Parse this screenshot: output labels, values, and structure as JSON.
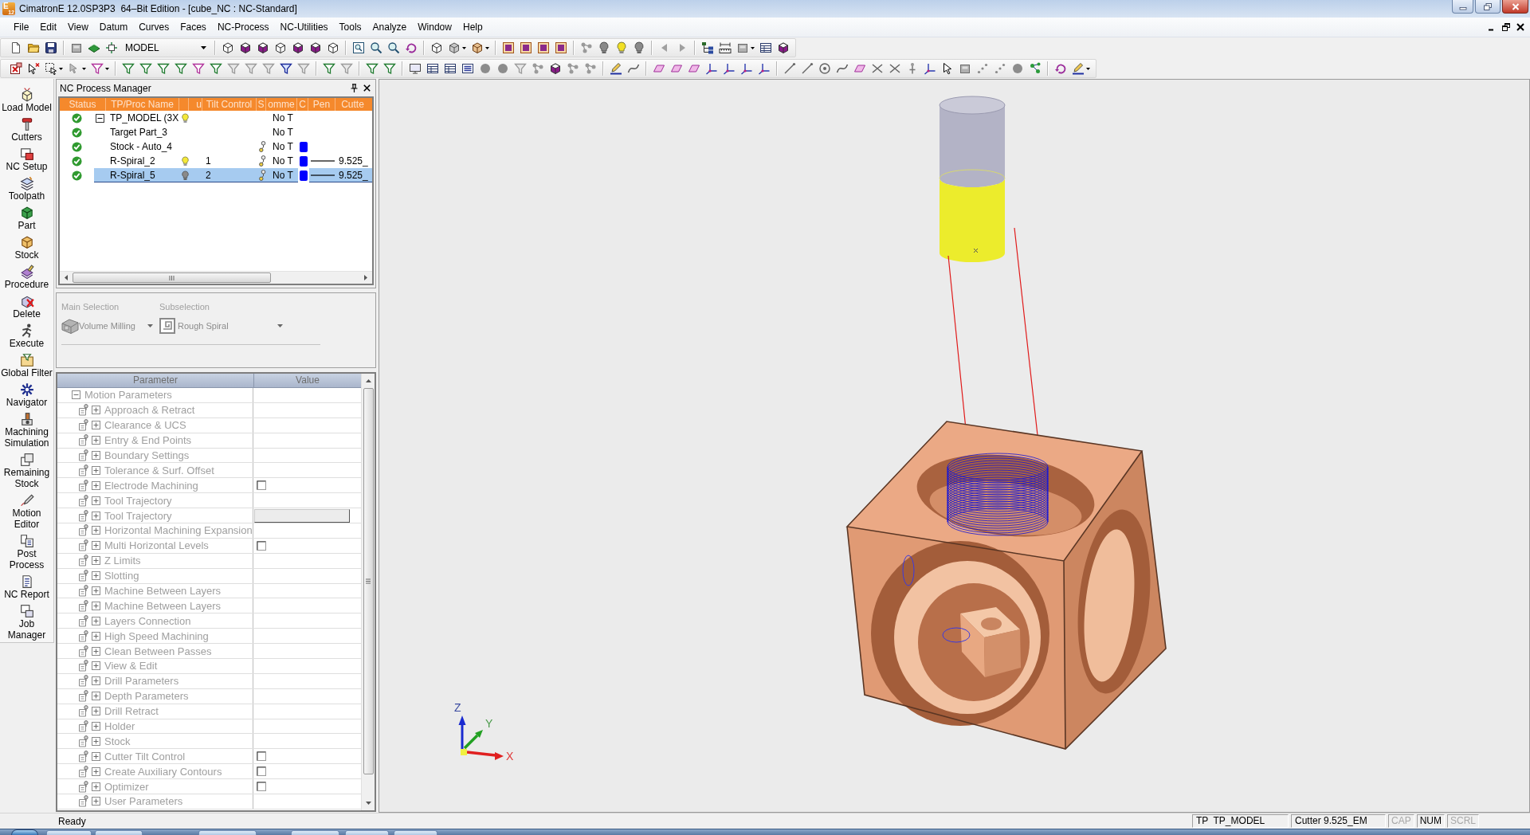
{
  "window": {
    "logo": {
      "letter": "E",
      "version": "12"
    },
    "title": "CimatronE 12.0SP3P3  64–Bit Edition - [cube_NC : NC-Standard]"
  },
  "menu": {
    "items": [
      "File",
      "Edit",
      "View",
      "Datum",
      "Curves",
      "Faces",
      "NC-Process",
      "NC-Utilities",
      "Tools",
      "Analyze",
      "Window",
      "Help"
    ]
  },
  "toolbar": {
    "view_combo": {
      "value": "MODEL"
    }
  },
  "sidebar": {
    "items": [
      "Load Model",
      "Cutters",
      "NC Setup",
      "Toolpath",
      "Part",
      "Stock",
      "Procedure",
      "Delete",
      "Execute",
      "Global Filter",
      "Navigator",
      "Machining Simulation",
      "Remaining Stock",
      "Motion Editor",
      "Post Process",
      "NC Report",
      "Job Manager"
    ]
  },
  "nc_process_manager": {
    "title": "NC Process Manager",
    "columns": [
      "Status",
      "TP/Proc Name",
      "u",
      "Tilt Control",
      "S",
      "omme",
      "C",
      "Pen",
      "Cutte"
    ],
    "tree": [
      {
        "name": "TP_MODEL (3X",
        "done": true,
        "bulb_on": true,
        "column_7": "No T",
        "expanded": true,
        "selected": false,
        "children": [
          {
            "name": "Target Part_3",
            "done": true,
            "column_7": "No T",
            "selected": false
          },
          {
            "name": "Stock - Auto_4",
            "done": true,
            "column_6_icon": true,
            "column_7": "No T",
            "color": "#0000ff",
            "selected": false
          },
          {
            "name": "R-Spiral_2",
            "done": true,
            "bulb_on": true,
            "tilt_control": "1",
            "column_6_icon": true,
            "column_7": "No T",
            "color": "#0000ff",
            "pen_line": true,
            "column_10": "9.525_",
            "selected": false
          },
          {
            "name": "R-Spiral_5",
            "done": true,
            "bulb_on": false,
            "tilt_control": "2",
            "column_6_icon": true,
            "column_7": "No T",
            "color": "#0000ff",
            "pen_line": true,
            "column_10": "9.525_",
            "selected": true
          }
        ]
      }
    ]
  },
  "selection": {
    "main": {
      "label": "Main Selection",
      "value": "Volume Milling",
      "disabled": true
    },
    "sub": {
      "label": "Subselection",
      "value": "Rough Spiral",
      "disabled": true
    }
  },
  "parameters": {
    "columns": [
      "Parameter",
      "Value"
    ],
    "disabled": true,
    "tree": [
      {
        "label": "Motion Parameters",
        "expanded": true,
        "children": [
          {
            "label": "Approach & Retract",
            "expanded": false,
            "kind": "plain"
          },
          {
            "label": "Clearance & UCS",
            "expanded": false,
            "kind": "plain"
          },
          {
            "label": "Entry & End Points",
            "expanded": false,
            "kind": "plain"
          },
          {
            "label": "Boundary Settings",
            "expanded": false,
            "kind": "plain"
          },
          {
            "label": "Tolerance & Surf. Offset",
            "expanded": false,
            "kind": "plain"
          },
          {
            "label": "Electrode Machining",
            "expanded": false,
            "kind": "checkbox",
            "checked": false
          },
          {
            "label": "Tool Trajectory",
            "expanded": false,
            "kind": "plain"
          },
          {
            "label": "Tool Trajectory",
            "expanded": false,
            "kind": "field"
          },
          {
            "label": "Horizontal Machining Expansion",
            "expanded": false,
            "kind": "plain"
          },
          {
            "label": "Multi Horizontal Levels",
            "expanded": false,
            "kind": "checkbox",
            "checked": false
          },
          {
            "label": "Z Limits",
            "expanded": false,
            "kind": "plain"
          },
          {
            "label": "Slotting",
            "expanded": false,
            "kind": "plain"
          },
          {
            "label": "Machine Between Layers",
            "expanded": false,
            "kind": "plain"
          },
          {
            "label": "Machine Between Layers",
            "expanded": false,
            "kind": "plain"
          },
          {
            "label": "Layers Connection",
            "expanded": false,
            "kind": "plain"
          },
          {
            "label": "High Speed Machining",
            "expanded": false,
            "kind": "plain"
          },
          {
            "label": "Clean Between Passes",
            "expanded": false,
            "kind": "plain"
          },
          {
            "label": "View & Edit",
            "expanded": false,
            "kind": "plain"
          },
          {
            "label": "Drill Parameters",
            "expanded": false,
            "kind": "plain"
          },
          {
            "label": "Depth Parameters",
            "expanded": false,
            "kind": "plain"
          },
          {
            "label": "Drill Retract",
            "expanded": false,
            "kind": "plain"
          },
          {
            "label": "Holder",
            "expanded": false,
            "kind": "plain"
          },
          {
            "label": "Stock",
            "expanded": false,
            "kind": "plain"
          },
          {
            "label": "Cutter Tilt Control",
            "expanded": false,
            "kind": "checkbox",
            "checked": false
          },
          {
            "label": "Create Auxiliary Contours",
            "expanded": false,
            "kind": "checkbox",
            "checked": false
          },
          {
            "label": "Optimizer",
            "expanded": false,
            "kind": "checkbox",
            "checked": false
          },
          {
            "label": "User Parameters",
            "expanded": false,
            "kind": "plain"
          }
        ]
      }
    ]
  },
  "viewport": {
    "axis_triad": {
      "x": "X",
      "y": "Y",
      "z": "Z"
    }
  },
  "status_bar": {
    "message": "Ready",
    "panels": [
      "TP  TP_MODEL",
      "Cutter 9.525_EM"
    ],
    "indicators": [
      {
        "label": "CAP",
        "on": false
      },
      {
        "label": "NUM",
        "on": true
      },
      {
        "label": "SCRL",
        "on": false
      }
    ]
  }
}
